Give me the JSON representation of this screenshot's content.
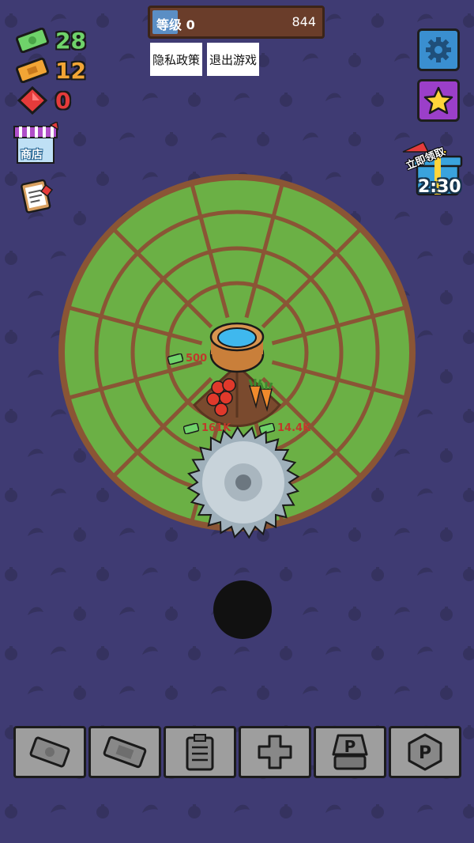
{
  "currencies": [
    {
      "name": "cash",
      "icon": "cash-icon",
      "value": "28",
      "color": "#6fd36a"
    },
    {
      "name": "tickets",
      "icon": "ticket-icon",
      "value": "12",
      "color": "#f2a535"
    },
    {
      "name": "gems",
      "icon": "gem-icon",
      "value": "0",
      "color": "#e53b3b"
    }
  ],
  "level": {
    "label": "等级 0",
    "value": "844",
    "progress": 0.15
  },
  "menu": {
    "privacy": "隐私政策",
    "exit": "退出游戏"
  },
  "shop": {
    "label": "商店"
  },
  "gift": {
    "label": "立即领取",
    "timer": "2:30"
  },
  "field": {
    "money_tags": [
      {
        "id": "tag-500",
        "value": "500"
      },
      {
        "id": "tag-161k",
        "value": "161K"
      },
      {
        "id": "tag-14k",
        "value": "14.4K"
      }
    ]
  },
  "bottom_buttons": [
    "cash-upgrade",
    "ticket-upgrade",
    "tasks",
    "add",
    "parking-sign",
    "parking-badge"
  ],
  "colors": {
    "background": "#3f3b73",
    "grass": "#6bb045",
    "soil": "#8a5535",
    "bottom_button": "#9e9e9e"
  }
}
